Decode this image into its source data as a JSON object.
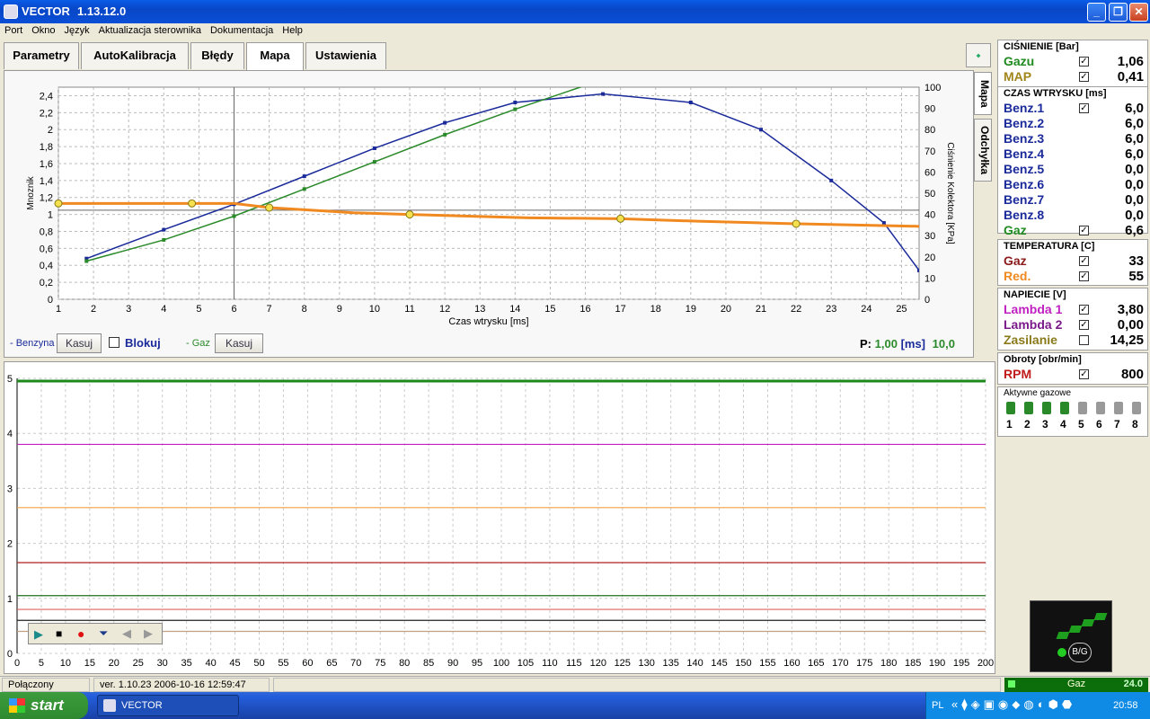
{
  "window": {
    "title": "VECTOR",
    "version": "1.13.12.0"
  },
  "menu": [
    "Port",
    "Okno",
    "Język",
    "Aktualizacja sterownika",
    "Dokumentacja",
    "Help"
  ],
  "tabs": [
    "Parametry",
    "AutoKalibracja",
    "Błędy",
    "Mapa",
    "Ustawienia"
  ],
  "vtabs": [
    "Mapa",
    "Odchyłka"
  ],
  "map": {
    "left_ticks": [
      "2,4",
      "2,2",
      "2",
      "1,8",
      "1,6",
      "1,4",
      "1,2",
      "1",
      "0,8",
      "0,6",
      "0,4",
      "0,2",
      "0"
    ],
    "right_ticks": [
      "100",
      "90",
      "80",
      "70",
      "60",
      "50",
      "40",
      "30",
      "20",
      "10",
      "0"
    ],
    "x_ticks": [
      "1",
      "2",
      "3",
      "4",
      "5",
      "6",
      "7",
      "8",
      "9",
      "10",
      "11",
      "12",
      "13",
      "14",
      "15",
      "16",
      "17",
      "18",
      "19",
      "20",
      "21",
      "22",
      "23",
      "24",
      "25"
    ],
    "ylabel_left": "Mnoznik",
    "ylabel_right": "Ciśnienie Kolektora [KPa]",
    "xlabel": "Czas wtrysku [ms]",
    "benzyna_label": "- Benzyna",
    "kasuj": "Kasuj",
    "blokuj": "Blokuj",
    "gaz_label": "- Gaz",
    "p_label": "P:",
    "p_value": "1,00",
    "p_unit": "[ms]",
    "p_value2": "10,0"
  },
  "chart_data": [
    {
      "type": "line",
      "xlabel": "Czas wtrysku [ms]",
      "ylabel": "Mnoznik",
      "y2label": "Ciśnienie Kolektora [KPa]",
      "xlim": [
        1,
        25.5
      ],
      "ylim": [
        0,
        2.5
      ],
      "y2lim": [
        0,
        100
      ],
      "series": [
        {
          "color": "#1A2A9A",
          "x": [
            1.8,
            4,
            6,
            8,
            10,
            12,
            14,
            16.5,
            19,
            21,
            23,
            24.5,
            25.5
          ],
          "y": [
            0.48,
            0.82,
            1.12,
            1.45,
            1.78,
            2.08,
            2.32,
            2.42,
            2.32,
            2.0,
            1.4,
            0.9,
            0.34
          ]
        },
        {
          "color": "#2A8A2A",
          "x": [
            1.8,
            4,
            6,
            8,
            10,
            12,
            14,
            16
          ],
          "y": [
            0.45,
            0.7,
            0.98,
            1.3,
            1.62,
            1.94,
            2.24,
            2.52
          ]
        },
        {
          "color": "#F08A20",
          "x": [
            1,
            4.8,
            6,
            7,
            9.4,
            11,
            14.4,
            17,
            19.2,
            22,
            25.5
          ],
          "y": [
            1.13,
            1.13,
            1.13,
            1.08,
            1.02,
            1.0,
            0.96,
            0.95,
            0.92,
            0.89,
            0.86
          ]
        }
      ]
    },
    {
      "type": "line",
      "xlim": [
        0,
        200
      ],
      "ylim": [
        0,
        5
      ],
      "xticks": [
        "0",
        "5",
        "10",
        "15",
        "20",
        "25",
        "30",
        "35",
        "40",
        "45",
        "50",
        "55",
        "60",
        "65",
        "70",
        "75",
        "80",
        "85",
        "90",
        "95",
        "100",
        "105",
        "110",
        "115",
        "120",
        "125",
        "130",
        "135",
        "140",
        "145",
        "150",
        "155",
        "160",
        "165",
        "170",
        "175",
        "180",
        "185",
        "190",
        "195",
        "200"
      ],
      "yticks": [
        "0",
        "1",
        "2",
        "3",
        "4",
        "5"
      ],
      "series": [
        {
          "color": "#1B8A1B",
          "y": 4.95
        },
        {
          "color": "#C020C0",
          "y": 3.8
        },
        {
          "color": "#F0A040",
          "y": 2.65
        },
        {
          "color": "#B02020",
          "y": 1.65
        },
        {
          "color": "#207020",
          "y": 1.05
        },
        {
          "color": "#E06060",
          "y": 0.8
        },
        {
          "color": "#202020",
          "y": 0.6
        },
        {
          "color": "#C0A080",
          "y": 0.4
        }
      ]
    }
  ],
  "sidebar": {
    "pressure": {
      "title": "CIŚNIENIE [Bar]",
      "rows": [
        {
          "label": "Gazu",
          "color": "#1F8A1F",
          "value": "1,06"
        },
        {
          "label": "MAP",
          "color": "#A0861A",
          "value": "0,41"
        }
      ]
    },
    "injection": {
      "title": "CZAS WTRYSKU  [ms]",
      "rows": [
        {
          "label": "Benz.1",
          "color": "#1A2A9A",
          "value": "6,0",
          "chk": true
        },
        {
          "label": "Benz.2",
          "color": "#1A2A9A",
          "value": "6,0",
          "chk": false
        },
        {
          "label": "Benz.3",
          "color": "#1A2A9A",
          "value": "6,0",
          "chk": false
        },
        {
          "label": "Benz.4",
          "color": "#1A2A9A",
          "value": "6,0",
          "chk": false
        },
        {
          "label": "Benz.5",
          "color": "#1A2A9A",
          "value": "0,0",
          "chk": false
        },
        {
          "label": "Benz.6",
          "color": "#1A2A9A",
          "value": "0,0",
          "chk": false
        },
        {
          "label": "Benz.7",
          "color": "#1A2A9A",
          "value": "0,0",
          "chk": false
        },
        {
          "label": "Benz.8",
          "color": "#1A2A9A",
          "value": "0,0",
          "chk": false
        },
        {
          "label": "Gaz",
          "color": "#1F8A1F",
          "value": "6,6",
          "chk": true
        }
      ]
    },
    "temp": {
      "title": "TEMPERATURA  [C]",
      "rows": [
        {
          "label": "Gaz",
          "color": "#8A1A1A",
          "value": "33"
        },
        {
          "label": "Red.",
          "color": "#F08A20",
          "value": "55"
        }
      ]
    },
    "voltage": {
      "title": "NAPIECIE [V]",
      "rows": [
        {
          "label": "Lambda 1",
          "color": "#C020C0",
          "value": "3,80"
        },
        {
          "label": "Lambda 2",
          "color": "#7A1A8A",
          "value": "0,00"
        },
        {
          "label": "Zasilanie",
          "color": "#8A7A1A",
          "value": "14,25"
        }
      ]
    },
    "rpm": {
      "title": "Obroty [obr/min]",
      "rows": [
        {
          "label": "RPM",
          "color": "#C01A1A",
          "value": "800"
        }
      ]
    },
    "active_title": "Aktywne gazowe",
    "injectors": [
      "1",
      "2",
      "3",
      "4",
      "5",
      "6",
      "7",
      "8"
    ],
    "gaz_mode": "Gaz",
    "gaz_val": "24.0",
    "bg": "B/G"
  },
  "status": {
    "conn": "Połączony",
    "ver": "ver. 1.10.23  2006-10-16  12:59:47"
  },
  "taskbar": {
    "start": "start",
    "item": "VECTOR",
    "lang": "PL",
    "time": "20:58"
  }
}
